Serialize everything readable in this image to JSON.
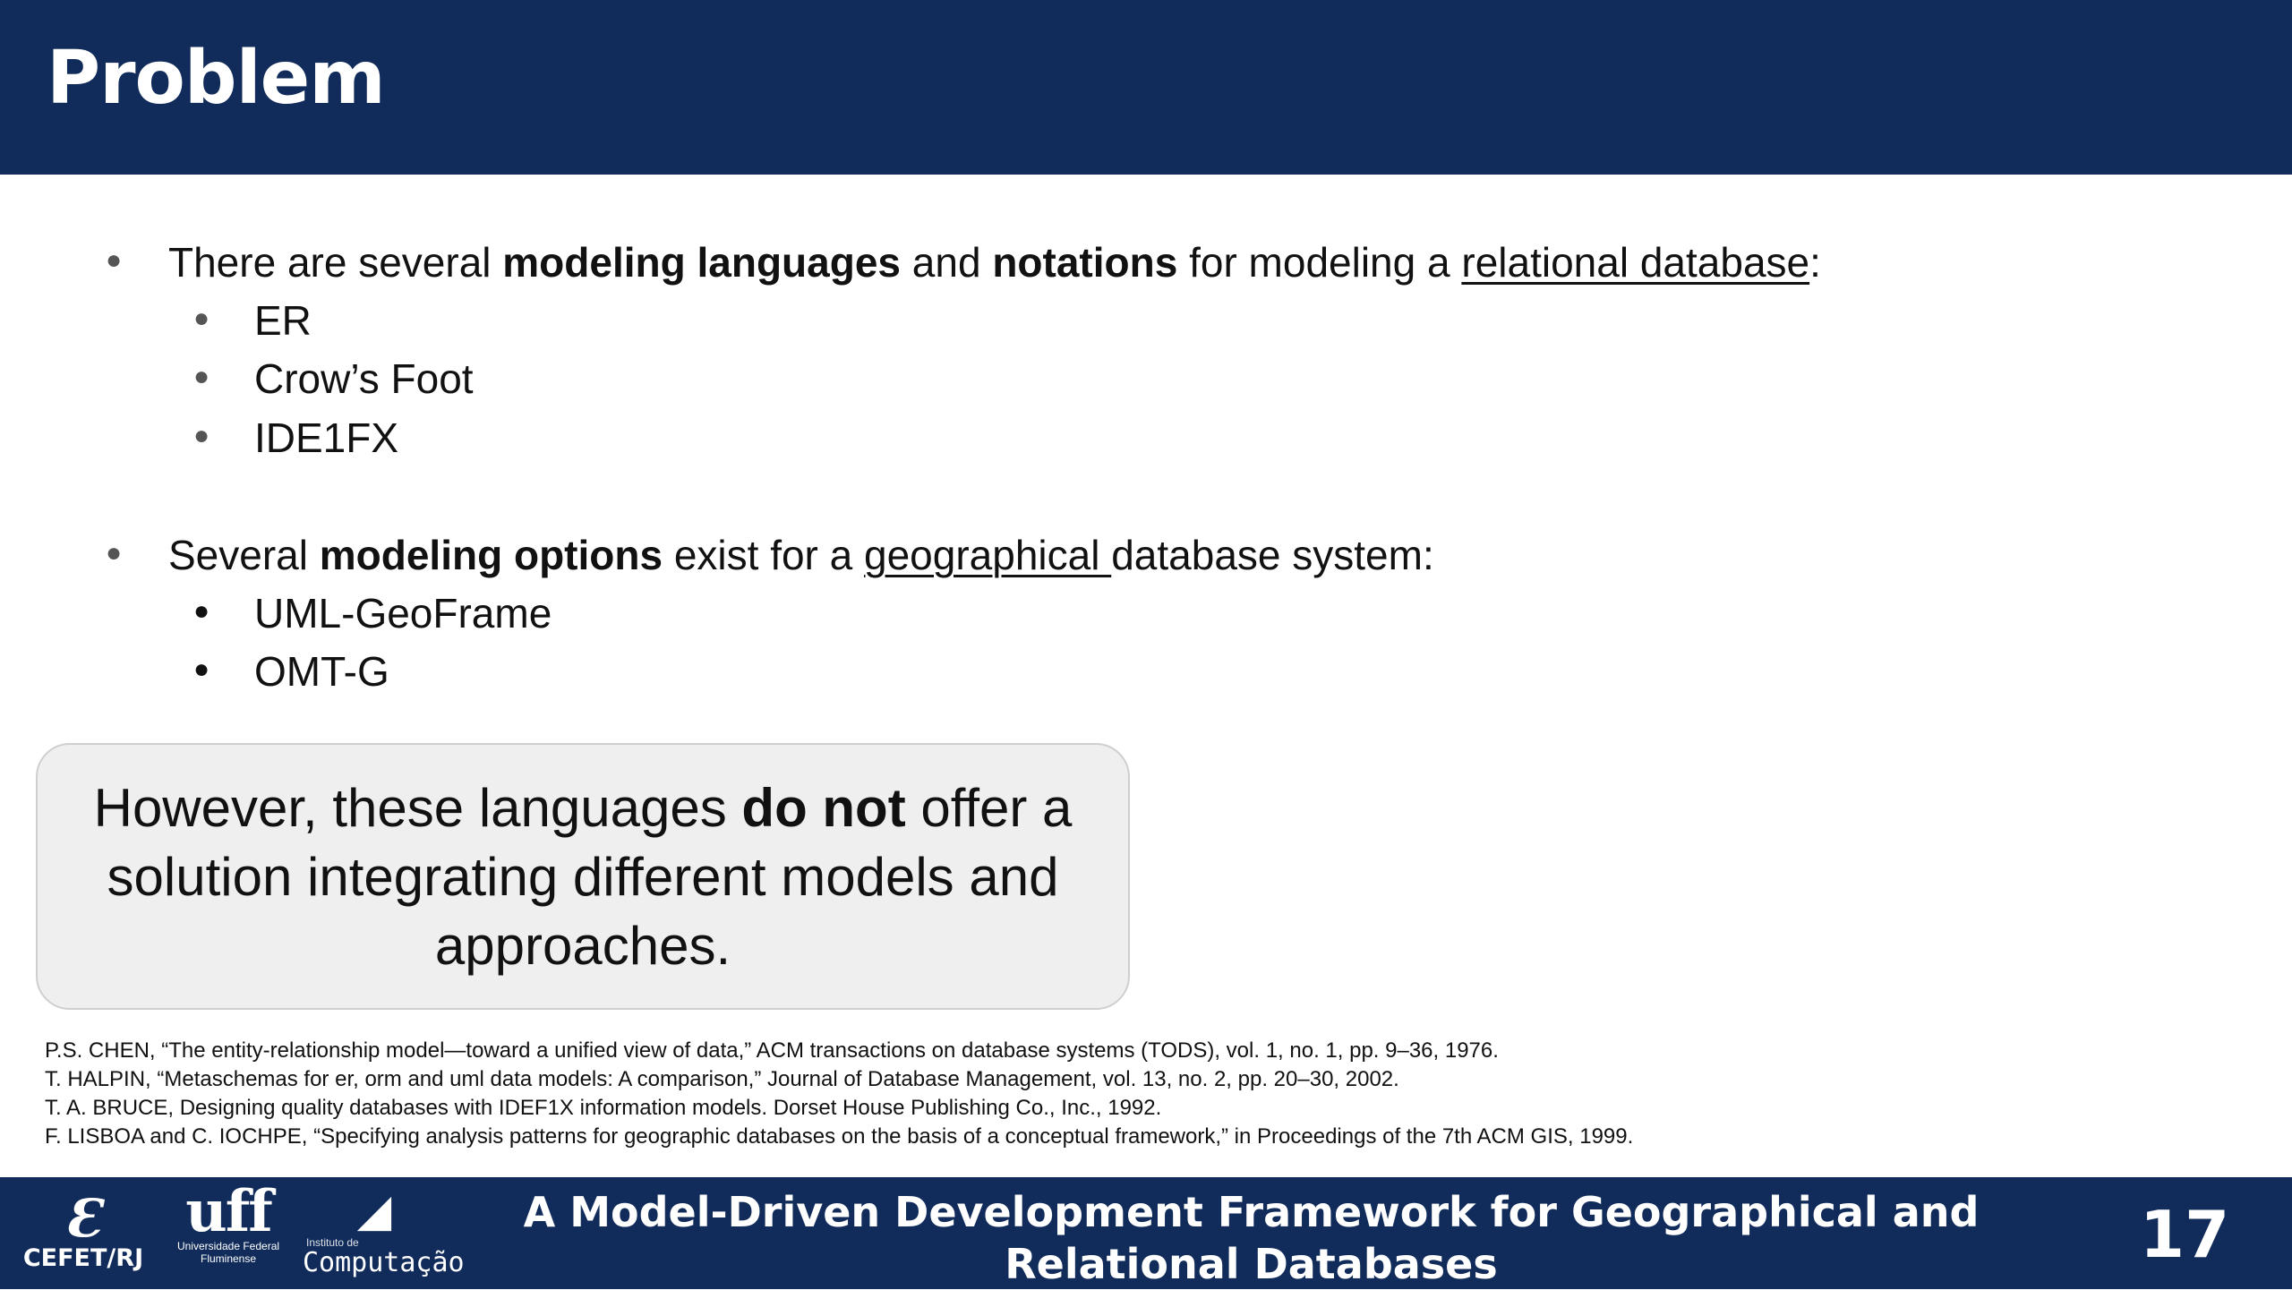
{
  "header": {
    "title": "Problem"
  },
  "bullets": [
    {
      "pre": "There are several ",
      "b1": "modeling languages",
      "mid": " and ",
      "b2": "notations",
      "post": " for modeling a ",
      "link": "relational database",
      "end": ":",
      "sub": [
        "ER",
        "Crow’s Foot",
        "IDE1FX"
      ]
    },
    {
      "pre": "Several ",
      "b1": "modeling options",
      "mid": " exist for a ",
      "link": "geographical ",
      "post": "database system:",
      "sub": [
        "UML-GeoFrame",
        "OMT-G"
      ]
    }
  ],
  "callout": {
    "pre": "However, these languages ",
    "bold": "do not",
    "post": " offer a solution integrating different models and approaches."
  },
  "references": [
    "P.S. CHEN, “The entity-relationship model—toward a unified view of data,” ACM transactions on database systems (TODS), vol. 1, no. 1, pp. 9–36, 1976.",
    "T. HALPIN, “Metaschemas for er, orm and uml data models: A comparison,” Journal of Database Management, vol. 13, no. 2, pp. 20–30, 2002.",
    "T. A. BRUCE, Designing quality databases with IDEF1X information models. Dorset House Publishing Co., Inc., 1992.",
    "F. LISBOA and C. IOCHPE, “Specifying analysis patterns for geographic databases on the basis of a conceptual framework,” in Proceedings of the 7th ACM GIS, 1999."
  ],
  "footer": {
    "title": "A Model-Driven Development Framework for Geographical and Relational Databases",
    "page_number": "17",
    "logos": {
      "cefet_mark": "Ɛ",
      "cefet_text": "CEFET/RJ",
      "uff_mark": "uff",
      "uff_text": "Universidade Federal Fluminense",
      "ic_small": "Instituto de",
      "ic_text": "Computação"
    }
  }
}
